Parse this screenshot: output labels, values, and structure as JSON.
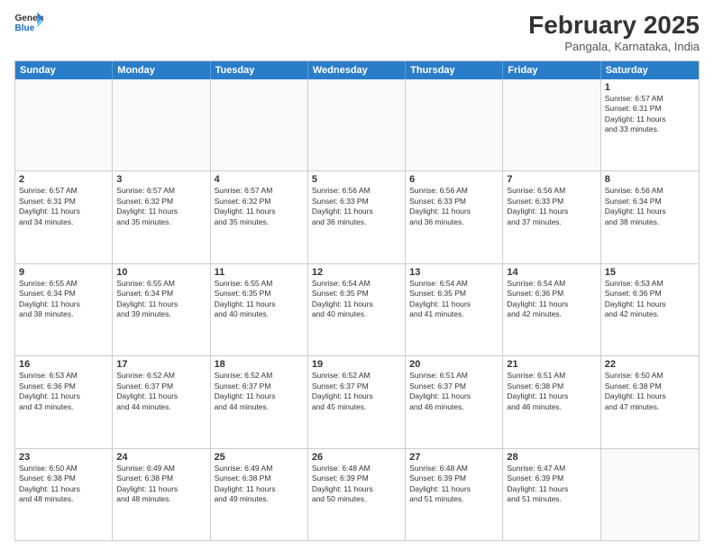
{
  "header": {
    "logo_general": "General",
    "logo_blue": "Blue",
    "month": "February 2025",
    "location": "Pangala, Karnataka, India"
  },
  "days_of_week": [
    "Sunday",
    "Monday",
    "Tuesday",
    "Wednesday",
    "Thursday",
    "Friday",
    "Saturday"
  ],
  "weeks": [
    [
      {
        "day": "",
        "info": ""
      },
      {
        "day": "",
        "info": ""
      },
      {
        "day": "",
        "info": ""
      },
      {
        "day": "",
        "info": ""
      },
      {
        "day": "",
        "info": ""
      },
      {
        "day": "",
        "info": ""
      },
      {
        "day": "1",
        "info": "Sunrise: 6:57 AM\nSunset: 6:31 PM\nDaylight: 11 hours\nand 33 minutes."
      }
    ],
    [
      {
        "day": "2",
        "info": "Sunrise: 6:57 AM\nSunset: 6:31 PM\nDaylight: 11 hours\nand 34 minutes."
      },
      {
        "day": "3",
        "info": "Sunrise: 6:57 AM\nSunset: 6:32 PM\nDaylight: 11 hours\nand 35 minutes."
      },
      {
        "day": "4",
        "info": "Sunrise: 6:57 AM\nSunset: 6:32 PM\nDaylight: 11 hours\nand 35 minutes."
      },
      {
        "day": "5",
        "info": "Sunrise: 6:56 AM\nSunset: 6:33 PM\nDaylight: 11 hours\nand 36 minutes."
      },
      {
        "day": "6",
        "info": "Sunrise: 6:56 AM\nSunset: 6:33 PM\nDaylight: 11 hours\nand 36 minutes."
      },
      {
        "day": "7",
        "info": "Sunrise: 6:56 AM\nSunset: 6:33 PM\nDaylight: 11 hours\nand 37 minutes."
      },
      {
        "day": "8",
        "info": "Sunrise: 6:56 AM\nSunset: 6:34 PM\nDaylight: 11 hours\nand 38 minutes."
      }
    ],
    [
      {
        "day": "9",
        "info": "Sunrise: 6:55 AM\nSunset: 6:34 PM\nDaylight: 11 hours\nand 38 minutes."
      },
      {
        "day": "10",
        "info": "Sunrise: 6:55 AM\nSunset: 6:34 PM\nDaylight: 11 hours\nand 39 minutes."
      },
      {
        "day": "11",
        "info": "Sunrise: 6:55 AM\nSunset: 6:35 PM\nDaylight: 11 hours\nand 40 minutes."
      },
      {
        "day": "12",
        "info": "Sunrise: 6:54 AM\nSunset: 6:35 PM\nDaylight: 11 hours\nand 40 minutes."
      },
      {
        "day": "13",
        "info": "Sunrise: 6:54 AM\nSunset: 6:35 PM\nDaylight: 11 hours\nand 41 minutes."
      },
      {
        "day": "14",
        "info": "Sunrise: 6:54 AM\nSunset: 6:36 PM\nDaylight: 11 hours\nand 42 minutes."
      },
      {
        "day": "15",
        "info": "Sunrise: 6:53 AM\nSunset: 6:36 PM\nDaylight: 11 hours\nand 42 minutes."
      }
    ],
    [
      {
        "day": "16",
        "info": "Sunrise: 6:53 AM\nSunset: 6:36 PM\nDaylight: 11 hours\nand 43 minutes."
      },
      {
        "day": "17",
        "info": "Sunrise: 6:52 AM\nSunset: 6:37 PM\nDaylight: 11 hours\nand 44 minutes."
      },
      {
        "day": "18",
        "info": "Sunrise: 6:52 AM\nSunset: 6:37 PM\nDaylight: 11 hours\nand 44 minutes."
      },
      {
        "day": "19",
        "info": "Sunrise: 6:52 AM\nSunset: 6:37 PM\nDaylight: 11 hours\nand 45 minutes."
      },
      {
        "day": "20",
        "info": "Sunrise: 6:51 AM\nSunset: 6:37 PM\nDaylight: 11 hours\nand 46 minutes."
      },
      {
        "day": "21",
        "info": "Sunrise: 6:51 AM\nSunset: 6:38 PM\nDaylight: 11 hours\nand 46 minutes."
      },
      {
        "day": "22",
        "info": "Sunrise: 6:50 AM\nSunset: 6:38 PM\nDaylight: 11 hours\nand 47 minutes."
      }
    ],
    [
      {
        "day": "23",
        "info": "Sunrise: 6:50 AM\nSunset: 6:38 PM\nDaylight: 11 hours\nand 48 minutes."
      },
      {
        "day": "24",
        "info": "Sunrise: 6:49 AM\nSunset: 6:38 PM\nDaylight: 11 hours\nand 48 minutes."
      },
      {
        "day": "25",
        "info": "Sunrise: 6:49 AM\nSunset: 6:38 PM\nDaylight: 11 hours\nand 49 minutes."
      },
      {
        "day": "26",
        "info": "Sunrise: 6:48 AM\nSunset: 6:39 PM\nDaylight: 11 hours\nand 50 minutes."
      },
      {
        "day": "27",
        "info": "Sunrise: 6:48 AM\nSunset: 6:39 PM\nDaylight: 11 hours\nand 51 minutes."
      },
      {
        "day": "28",
        "info": "Sunrise: 6:47 AM\nSunset: 6:39 PM\nDaylight: 11 hours\nand 51 minutes."
      },
      {
        "day": "",
        "info": ""
      }
    ]
  ]
}
